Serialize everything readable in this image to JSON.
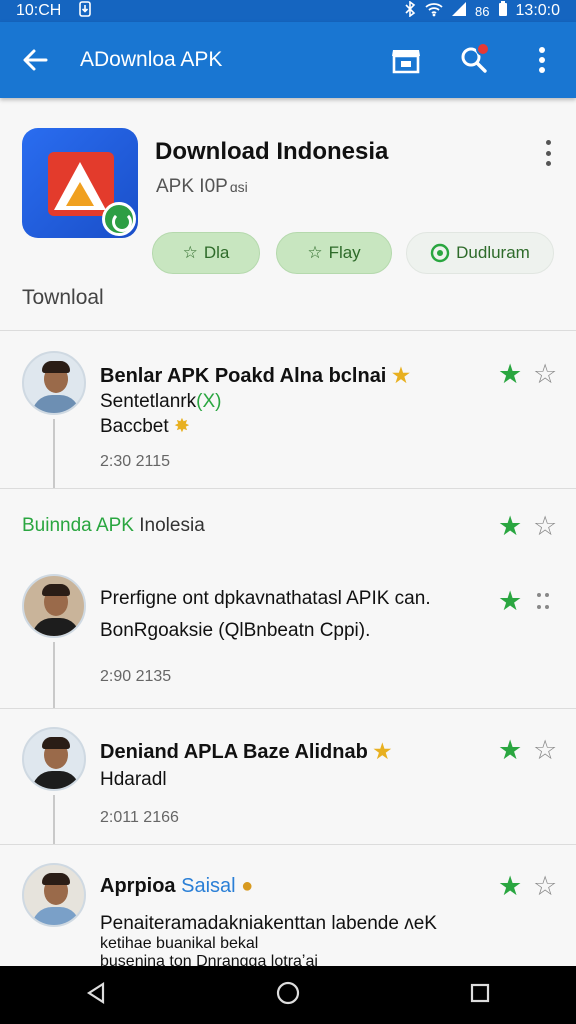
{
  "status_bar": {
    "time_left": "10:CH",
    "time_right": "13:0:0",
    "extra": "86"
  },
  "app_bar": {
    "title": "ADownloa APK"
  },
  "app": {
    "name": "Download Indonesia",
    "subtitle": "APK I0P",
    "subtitle_small": "ɑsi",
    "buttons": [
      {
        "label": "Dla",
        "icon": "star-outline-icon"
      },
      {
        "label": "Flay",
        "icon": "star-outline-icon"
      },
      {
        "label": "Dudluram",
        "icon": "whatsapp-icon"
      }
    ],
    "section_label": "Townloal"
  },
  "reviews": [
    {
      "title": "Benlar APK Poakd Alna bclnai",
      "line1": "Sentetlanrk",
      "line1_extra": "(X)",
      "line2": "Baccbet",
      "time": "2:30 2115",
      "star_on": "★",
      "star_off": "☆"
    },
    {
      "title_green": "Buinnda APK",
      "title_plain": "Inolesia",
      "star_on": "★",
      "star_off": "☆"
    },
    {
      "line1": "Prerfigne ont dpkavnathatasl APIK can.",
      "line2": "BonRgoaksie (QlBnbeatn Cppi).",
      "time": "2:90 2135",
      "star_on": "★"
    },
    {
      "title": "Deniand APLA Baze Alidnab",
      "line1": "Hdaradl",
      "time": "2:011 2166",
      "star_on": "★",
      "star_off": "☆"
    },
    {
      "title": "Aprpioa",
      "title_blue": "Saisal",
      "line1": "Penaiteramadakniakenttan labende ᴧeK",
      "line2": "ketihae buanikal bekal",
      "line3": "busenina ton Dnrangga lotraʼai",
      "star_on": "★",
      "star_off": "☆"
    }
  ]
}
